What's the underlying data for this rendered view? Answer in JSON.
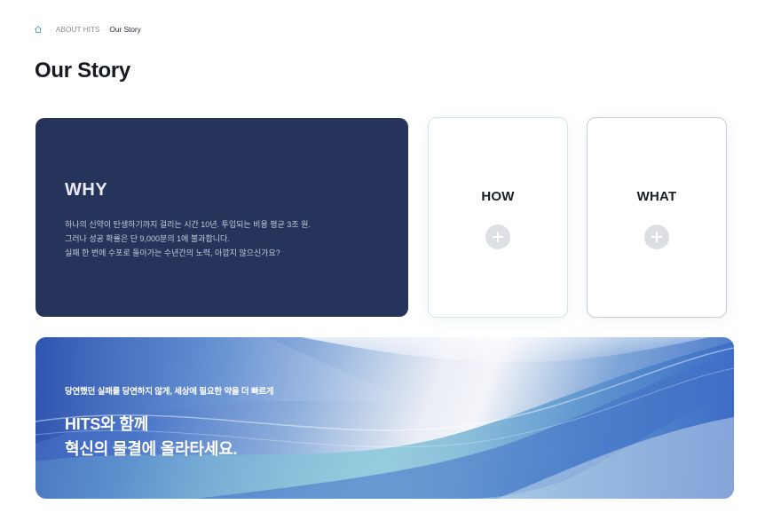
{
  "breadcrumb": {
    "home_icon": "home-icon",
    "items": [
      "ABOUT HITS",
      "Our Story"
    ]
  },
  "page": {
    "title": "Our Story"
  },
  "why": {
    "title": "WHY",
    "lines": [
      "하나의 신약이 탄생하기까지 걸리는 시간 10년. 투입되는 비용 평균 3조 원.",
      "그러나 성공 확률은 단 9,000분의 1에 불과합니다.",
      "실패 한 번에 수포로 돌아가는 수년간의 노력, 아깝지 않으신가요?"
    ],
    "background": "#26335a"
  },
  "how": {
    "title": "HOW",
    "icon": "plus-icon"
  },
  "what": {
    "title": "WHAT",
    "icon": "plus-icon"
  },
  "banner": {
    "subtitle": "당연했던 실패를 당연하지 않게, 세상에 필요한 약을 더 빠르게",
    "title_lines": [
      "HITS와 함께",
      "혁신의 물결에 올라타세요."
    ]
  }
}
